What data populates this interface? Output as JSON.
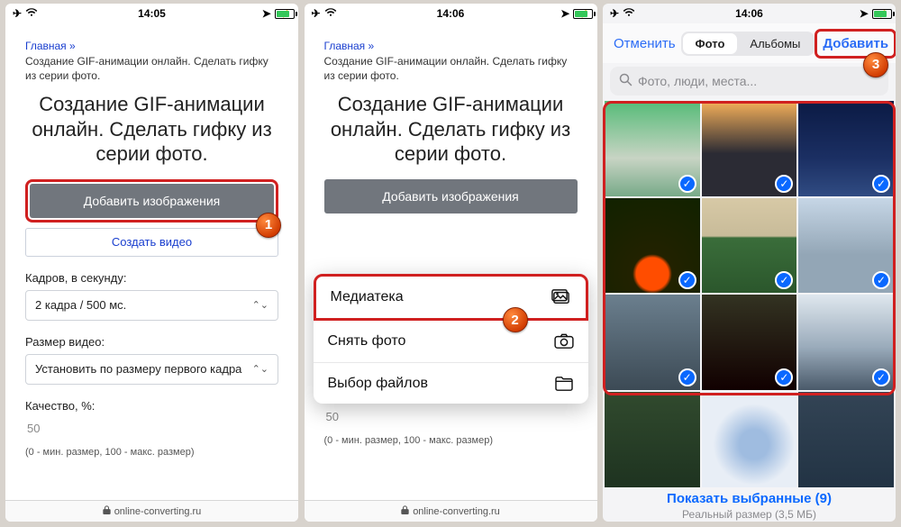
{
  "status": {
    "time1": "14:05",
    "time2": "14:06",
    "time3": "14:06"
  },
  "page": {
    "breadcrumb_home": "Главная",
    "breadcrumb_sep": "»",
    "breadcrumb_sub": "Создание GIF-анимации онлайн. Сделать гифку из серии фото.",
    "title": "Создание GIF-анимации онлайн. Сделать гифку из серии фото.",
    "btn_add_images": "Добавить изображения",
    "btn_create_video": "Создать видео",
    "fps_label": "Кадров, в секунду:",
    "fps_value": "2 кадра / 500 мс.",
    "size_label": "Размер видео:",
    "size_value": "Установить по размеру первого кадра",
    "quality_label": "Качество, %:",
    "quality_value": "50",
    "quality_hint": "(0 - мин. размер, 100 - макс. размер)",
    "footer_domain": "online-converting.ru"
  },
  "sheet": {
    "media": "Медиатека",
    "camera": "Снять фото",
    "files": "Выбор файлов"
  },
  "picker": {
    "cancel": "Отменить",
    "seg_photos": "Фото",
    "seg_albums": "Альбомы",
    "add": "Добавить",
    "search_placeholder": "Фото, люди, места...",
    "show_selected": "Показать выбранные (9)",
    "real_size": "Реальный размер (3,5 МБ)"
  },
  "steps": {
    "s1": "1",
    "s2": "2",
    "s3": "3"
  }
}
